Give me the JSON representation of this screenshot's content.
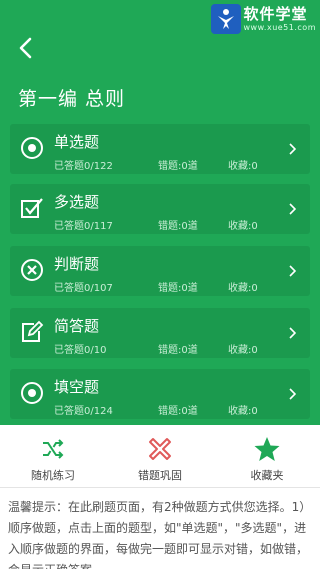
{
  "header": {
    "title": "第一编 总则"
  },
  "watermark": {
    "brand": "软件学堂",
    "url": "www.xue51.com"
  },
  "categories": [
    {
      "title": "单选题",
      "answered": "已答题0/122",
      "wrong": "错题:0道",
      "fav": "收藏:0",
      "icon": "target-icon"
    },
    {
      "title": "多选题",
      "answered": "已答题0/117",
      "wrong": "错题:0道",
      "fav": "收藏:0",
      "icon": "checkbox-icon"
    },
    {
      "title": "判断题",
      "answered": "已答题0/107",
      "wrong": "错题:0道",
      "fav": "收藏:0",
      "icon": "cross-circle-icon"
    },
    {
      "title": "简答题",
      "answered": "已答题0/10",
      "wrong": "错题:0道",
      "fav": "收藏:0",
      "icon": "edit-icon"
    },
    {
      "title": "填空题",
      "answered": "已答题0/124",
      "wrong": "错题:0道",
      "fav": "收藏:0",
      "icon": "target-icon"
    }
  ],
  "actions": [
    {
      "label": "随机练习",
      "icon": "shuffle-icon"
    },
    {
      "label": "错题巩固",
      "icon": "wrong-icon"
    },
    {
      "label": "收藏夹",
      "icon": "star-icon"
    }
  ],
  "tips": {
    "text": "温馨提示：在此刷题页面，有2种做题方式供您选择。1）顺序做题，点击上面的题型，如\"单选题\"，\"多选题\"，进入顺序做题的界面，每做完一题即可显示对错，如做错，会显示正确答案。"
  },
  "colors": {
    "primary": "#1fa856",
    "card": "#1b9a4e",
    "wrong": "#e05a5a",
    "accent_green": "#1fa856"
  }
}
